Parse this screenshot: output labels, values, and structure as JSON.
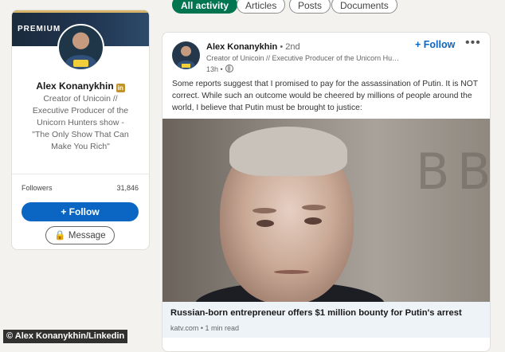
{
  "profile": {
    "premium_label": "PREMIUM",
    "name": "Alex Konanykhin",
    "headline": "Creator of Unicoin // Executive Producer of the Unicorn Hunters show - \"The Only Show That Can Make You Rich\"",
    "followers_label": "Followers",
    "followers_count": "31,846",
    "follow_label": "+ Follow",
    "message_label": "Message"
  },
  "tabs": [
    {
      "label": "All activity",
      "active": true
    },
    {
      "label": "Articles",
      "active": false
    },
    {
      "label": "Posts",
      "active": false
    },
    {
      "label": "Documents",
      "active": false
    }
  ],
  "post": {
    "author_name": "Alex Konanykhin",
    "degree": "• 2nd",
    "author_headline": "Creator of Unicoin // Executive Producer of the Unicorn Hunters show",
    "time": "13h •",
    "follow_label": "+ Follow",
    "more_label": "•••",
    "text": "Some reports suggest that I promised to pay for the assassination of Putin. It is NOT correct. While such an outcome would be cheered by millions of people around the world, I believe that Putin must be brought to justice:",
    "image_glyphs": [
      "B",
      "B"
    ],
    "link_title": "Russian-born entrepreneur offers $1 million bounty for Putin's arrest",
    "link_meta": "katv.com • 1 min read"
  },
  "caption": "© Alex Konanykhin/Linkedin"
}
